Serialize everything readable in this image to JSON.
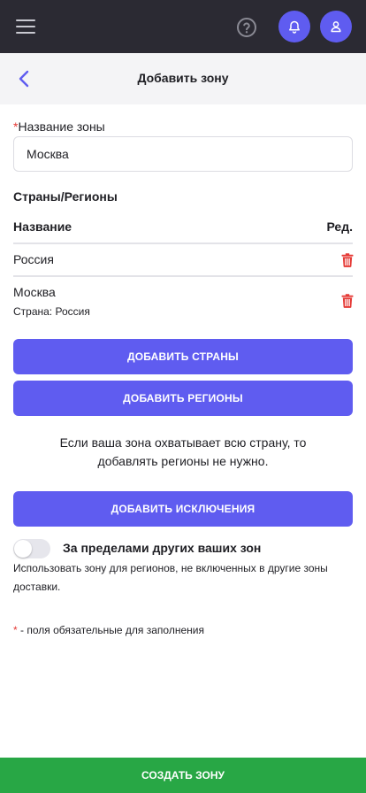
{
  "colors": {
    "topbar": "#2b2a33",
    "accent": "#5f5cf0",
    "danger": "#e53935",
    "success": "#28a745"
  },
  "topbar": {
    "menu_icon": "hamburger-icon",
    "help_icon": "question-circle-icon",
    "notifications_icon": "bell-icon",
    "profile_icon": "user-icon"
  },
  "header": {
    "back_icon": "chevron-left-icon",
    "title": "Добавить зону"
  },
  "form": {
    "zone_name_required_mark": "*",
    "zone_name_label": "Название зоны",
    "zone_name_value": "Москва"
  },
  "regions": {
    "section_title": "Страны/Регионы",
    "column_name": "Название",
    "column_edit": "Ред.",
    "rows": [
      {
        "name": "Россия",
        "sub": ""
      },
      {
        "name": "Москва",
        "sub": "Страна: Россия"
      }
    ]
  },
  "buttons": {
    "add_countries": "ДОБАВИТЬ СТРАНЫ",
    "add_regions": "ДОБАВИТЬ РЕГИОНЫ",
    "add_exclusions": "ДОБАВИТЬ ИСКЛЮЧЕНИЯ",
    "create_zone": "СОЗДАТЬ ЗОНУ"
  },
  "info_text": "Если ваша зона охватывает всю страну, то добавлять регионы не нужно.",
  "outside_zones": {
    "label": "За пределами других ваших зон",
    "description": "Использовать зону для регионов, не включенных в другие зоны доставки.",
    "enabled": false
  },
  "footer_note": {
    "mark": "*",
    "text": " - поля обязательные для заполнения"
  }
}
